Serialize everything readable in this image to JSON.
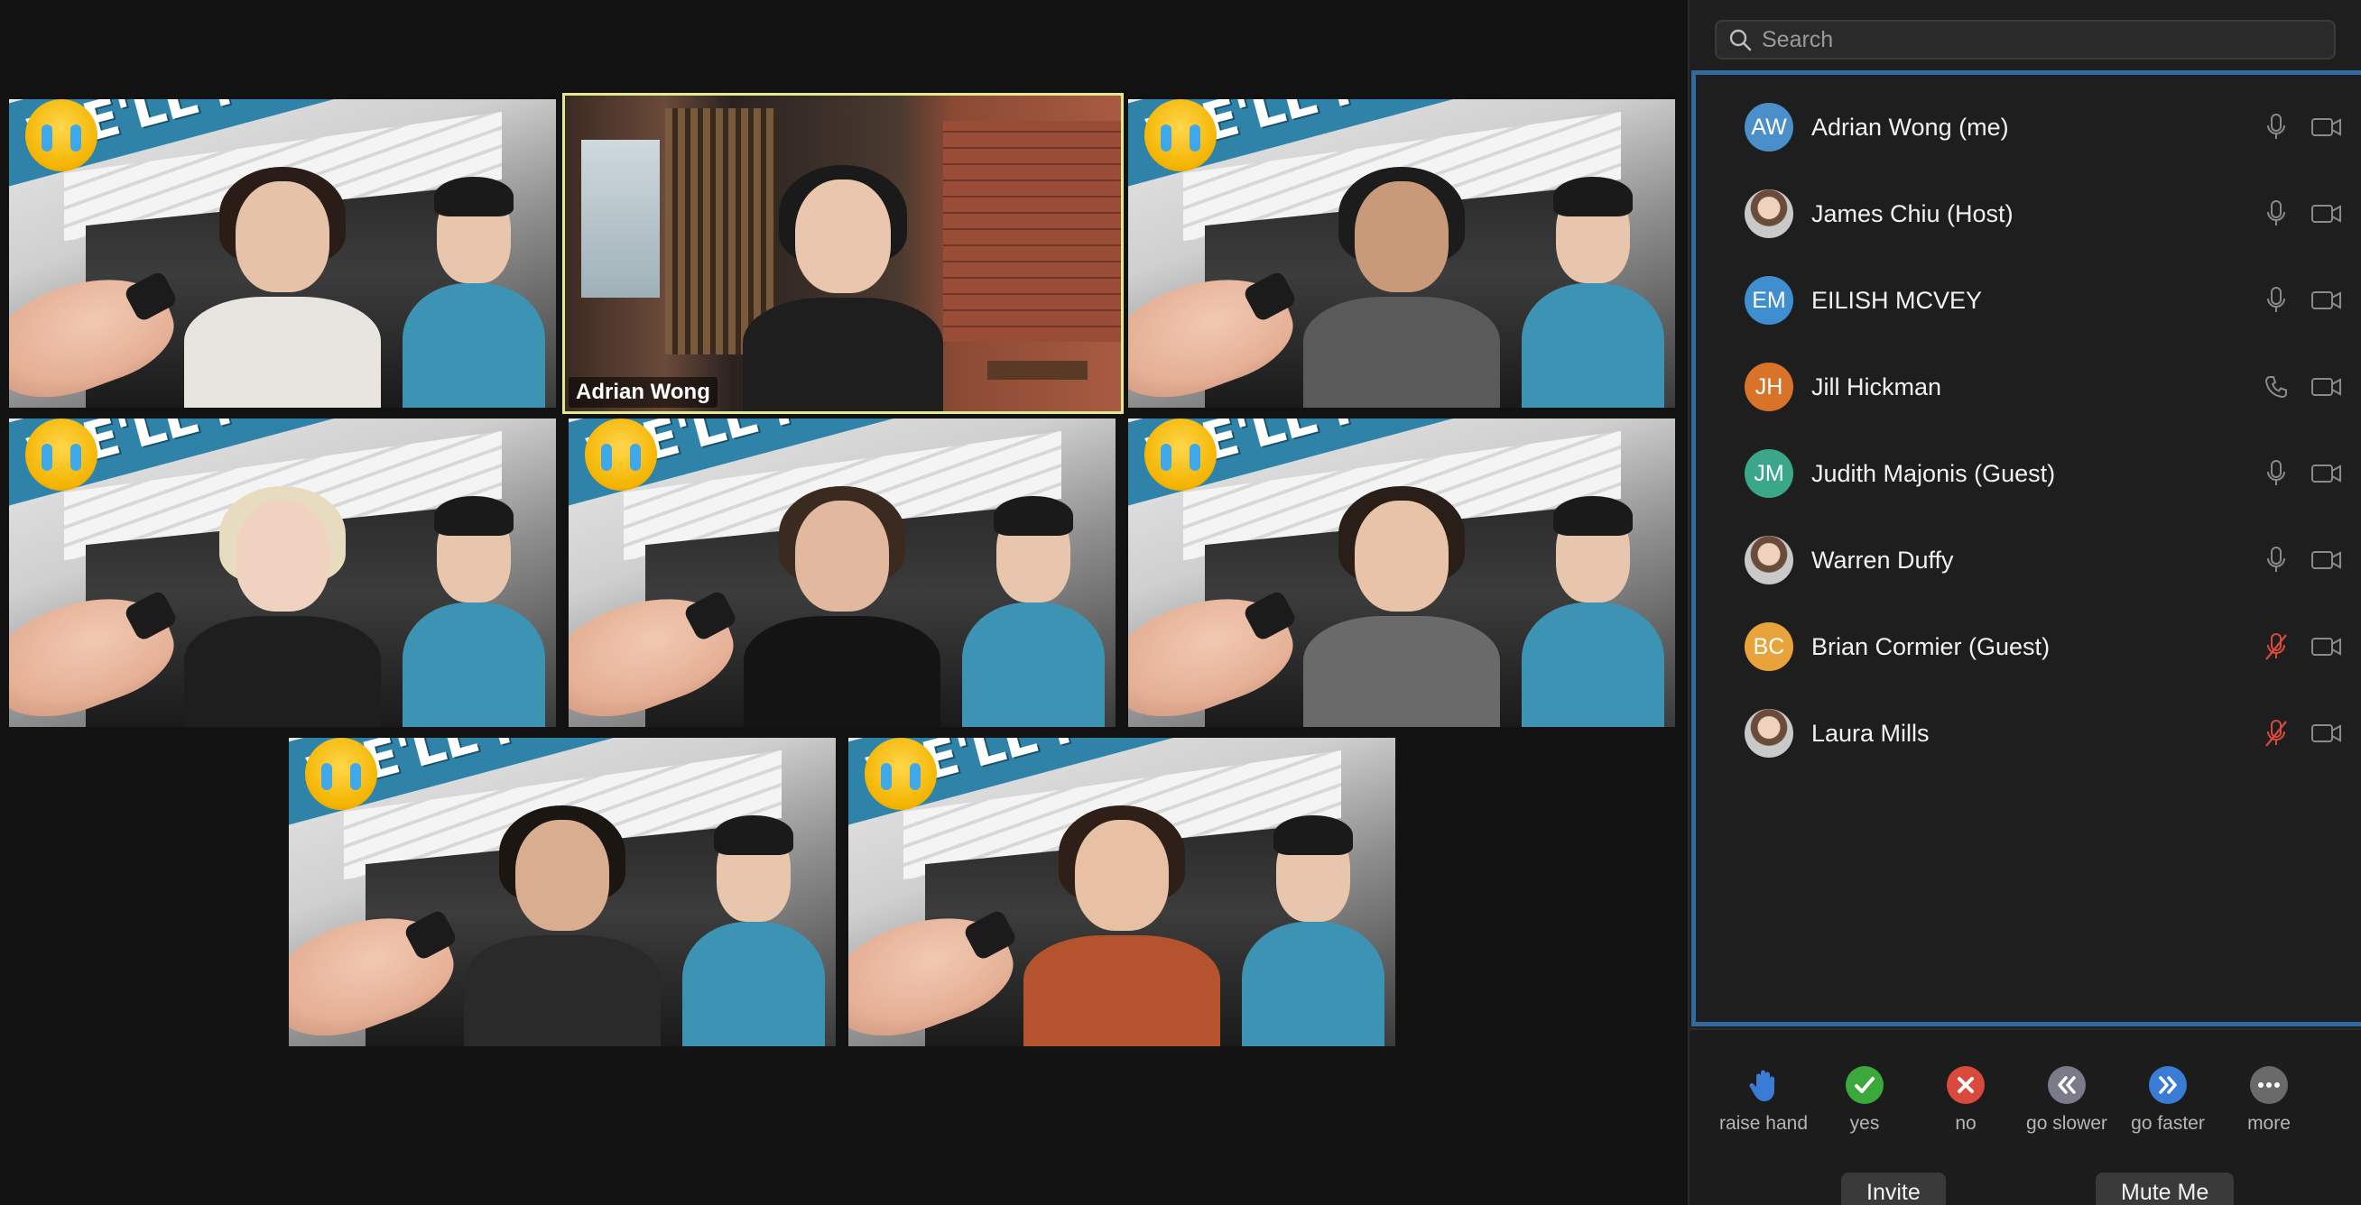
{
  "gallery": {
    "active_speaker_label": "Adrian Wong",
    "banner_text": "WE'LL MISS YOU"
  },
  "panel": {
    "search": {
      "placeholder": "Search",
      "value": ""
    },
    "participants": [
      {
        "initials": "AW",
        "name": "Adrian Wong (me)",
        "avatar_color": "#4a8fc9",
        "audio": "mic",
        "photo": false
      },
      {
        "initials": "",
        "name": "James Chiu (Host)",
        "avatar_color": "",
        "audio": "mic",
        "photo": true
      },
      {
        "initials": "EM",
        "name": "EILISH MCVEY",
        "avatar_color": "#3f8fd0",
        "audio": "mic",
        "photo": false
      },
      {
        "initials": "JH",
        "name": "Jill Hickman",
        "avatar_color": "#d8742a",
        "audio": "phone",
        "photo": false
      },
      {
        "initials": "JM",
        "name": "Judith Majonis (Guest)",
        "avatar_color": "#3aa78a",
        "audio": "mic",
        "photo": false
      },
      {
        "initials": "",
        "name": "Warren Duffy",
        "avatar_color": "",
        "audio": "mic",
        "photo": true
      },
      {
        "initials": "BC",
        "name": "Brian Cormier (Guest)",
        "avatar_color": "#e8a33a",
        "audio": "muted",
        "photo": false
      },
      {
        "initials": "",
        "name": "Laura Mills",
        "avatar_color": "",
        "audio": "muted",
        "photo": true
      }
    ],
    "reactions": [
      {
        "label": "raise hand",
        "icon": "raise-hand-icon",
        "color": "#3a7bd5"
      },
      {
        "label": "yes",
        "icon": "checkmark-icon",
        "color": "#3aa83a"
      },
      {
        "label": "no",
        "icon": "x-icon",
        "color": "#d9493c"
      },
      {
        "label": "go slower",
        "icon": "rewind-icon",
        "color": "#7a7a8a"
      },
      {
        "label": "go faster",
        "icon": "fast-forward-icon",
        "color": "#3a7bd5"
      },
      {
        "label": "more",
        "icon": "more-icon",
        "color": "#6a6a6a"
      }
    ],
    "footer": {
      "invite_label": "Invite",
      "mute_me_label": "Mute Me"
    }
  },
  "colors": {
    "active_speaker_border": "#e3e88a",
    "list_focus_border": "#2f6aa0",
    "muted_red": "#d9493c"
  }
}
